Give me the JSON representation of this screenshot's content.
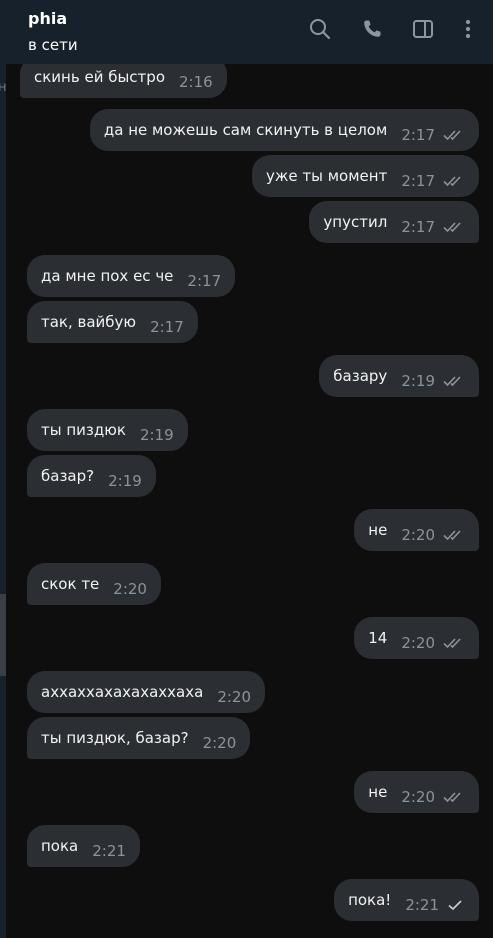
{
  "chat": {
    "title": "phia",
    "status": "в сети"
  },
  "edge": {
    "letter": "н"
  },
  "icons": {
    "search": "search-icon",
    "call": "phone-icon",
    "panel": "sidebar-toggle-icon",
    "more": "more-vertical-icon"
  },
  "messages": [
    {
      "dir": "in",
      "text": "скинь ей быстро",
      "time": "2:16"
    },
    {
      "dir": "out",
      "text": "да не можешь сам скинуть в целом",
      "time": "2:17",
      "read": true
    },
    {
      "dir": "out",
      "text": "уже ты момент",
      "time": "2:17",
      "read": true
    },
    {
      "dir": "out",
      "text": "упустил",
      "time": "2:17",
      "read": true
    },
    {
      "dir": "in",
      "text": "да мне пох ес че",
      "time": "2:17"
    },
    {
      "dir": "in",
      "text": "так, вайбую",
      "time": "2:17"
    },
    {
      "dir": "out",
      "text": "базару",
      "time": "2:19",
      "read": true
    },
    {
      "dir": "in",
      "text": "ты пиздюк",
      "time": "2:19"
    },
    {
      "dir": "in",
      "text": "базар?",
      "time": "2:19"
    },
    {
      "dir": "out",
      "text": "не",
      "time": "2:20",
      "read": true
    },
    {
      "dir": "in",
      "text": "скок те",
      "time": "2:20"
    },
    {
      "dir": "out",
      "text": "14",
      "time": "2:20",
      "read": true
    },
    {
      "dir": "in",
      "text": "аххаххахахахаххаха",
      "time": "2:20"
    },
    {
      "dir": "in",
      "text": "ты пиздюк, базар?",
      "time": "2:20"
    },
    {
      "dir": "out",
      "text": "не",
      "time": "2:20",
      "read": true
    },
    {
      "dir": "in",
      "text": "пока",
      "time": "2:21"
    },
    {
      "dir": "out",
      "text": "пока!",
      "time": "2:21",
      "read": false
    }
  ],
  "colors": {
    "header_bg": "#17212b",
    "chat_bg": "#0e0e0e",
    "bubble_bg": "#2b2f33",
    "time_color": "#8c9399"
  }
}
